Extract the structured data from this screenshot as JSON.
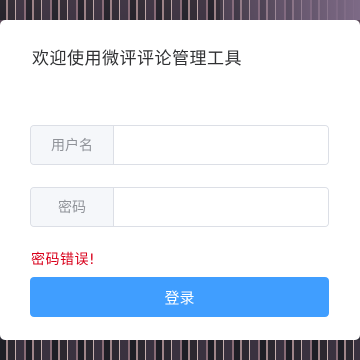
{
  "login": {
    "title": "欢迎使用微评评论管理工具",
    "username": {
      "label": "用户名",
      "value": "",
      "placeholder": ""
    },
    "password": {
      "label": "密码",
      "value": "",
      "placeholder": ""
    },
    "error_message": "密码错误!",
    "submit_label": "登录"
  },
  "colors": {
    "primary": "#409eff",
    "error": "#d9001b",
    "card_background": "#ffffff",
    "border": "#dcdfe6"
  }
}
